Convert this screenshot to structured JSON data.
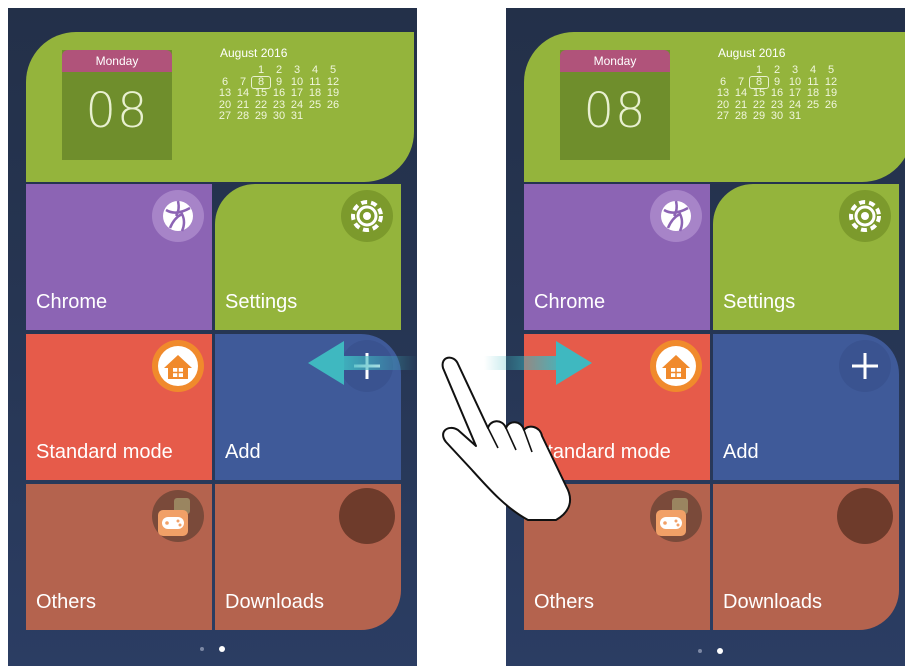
{
  "screens": [
    {
      "calendar": {
        "weekday": "Monday",
        "day": "08",
        "month_year": "August 2016",
        "dates": [
          "",
          "",
          "1",
          "2",
          "3",
          "4",
          "5",
          "6",
          "7",
          "8",
          "9",
          "10",
          "11",
          "12",
          "13",
          "14",
          "15",
          "16",
          "17",
          "18",
          "19",
          "20",
          "21",
          "22",
          "23",
          "24",
          "25",
          "26",
          "27",
          "28",
          "29",
          "30",
          "31"
        ],
        "today": "8"
      },
      "tiles": [
        {
          "label": "Chrome",
          "color": "#8c64b4",
          "icon": "browser-icon"
        },
        {
          "label": "Settings",
          "color": "#94b43c",
          "icon": "gear-icon"
        },
        {
          "label": "Standard mode",
          "color": "#e65b4a",
          "icon": "home-icon"
        },
        {
          "label": "Add",
          "color": "#3f5a99",
          "icon": "plus-icon"
        },
        {
          "label": "Others",
          "color": "#b4634e",
          "icon": "gamepad-folder-icon"
        },
        {
          "label": "Downloads",
          "color": "#b4634e",
          "icon": "downloads-circle-icon"
        }
      ],
      "page_indicator": {
        "pages": 2,
        "active": 2
      }
    },
    {
      "calendar": {
        "weekday": "Monday",
        "day": "08",
        "month_year": "August 2016",
        "dates": [
          "",
          "",
          "1",
          "2",
          "3",
          "4",
          "5",
          "6",
          "7",
          "8",
          "9",
          "10",
          "11",
          "12",
          "13",
          "14",
          "15",
          "16",
          "17",
          "18",
          "19",
          "20",
          "21",
          "22",
          "23",
          "24",
          "25",
          "26",
          "27",
          "28",
          "29",
          "30",
          "31"
        ],
        "today": "8"
      },
      "tiles": [
        {
          "label": "Chrome",
          "color": "#8c64b4",
          "icon": "browser-icon"
        },
        {
          "label": "Settings",
          "color": "#94b43c",
          "icon": "gear-icon"
        },
        {
          "label": "Standard mode",
          "color": "#e65b4a",
          "icon": "home-icon"
        },
        {
          "label": "Add",
          "color": "#3f5a99",
          "icon": "plus-icon"
        },
        {
          "label": "Others",
          "color": "#b4634e",
          "icon": "gamepad-folder-icon"
        },
        {
          "label": "Downloads",
          "color": "#b4634e",
          "icon": "downloads-circle-icon"
        }
      ],
      "page_indicator": {
        "pages": 2,
        "active": 2
      }
    }
  ],
  "gesture": {
    "left_arrow": "arrow-left-icon",
    "right_arrow": "arrow-right-icon",
    "hand": "hand-swipe-icon",
    "arrow_color": "#3fb8c0"
  }
}
